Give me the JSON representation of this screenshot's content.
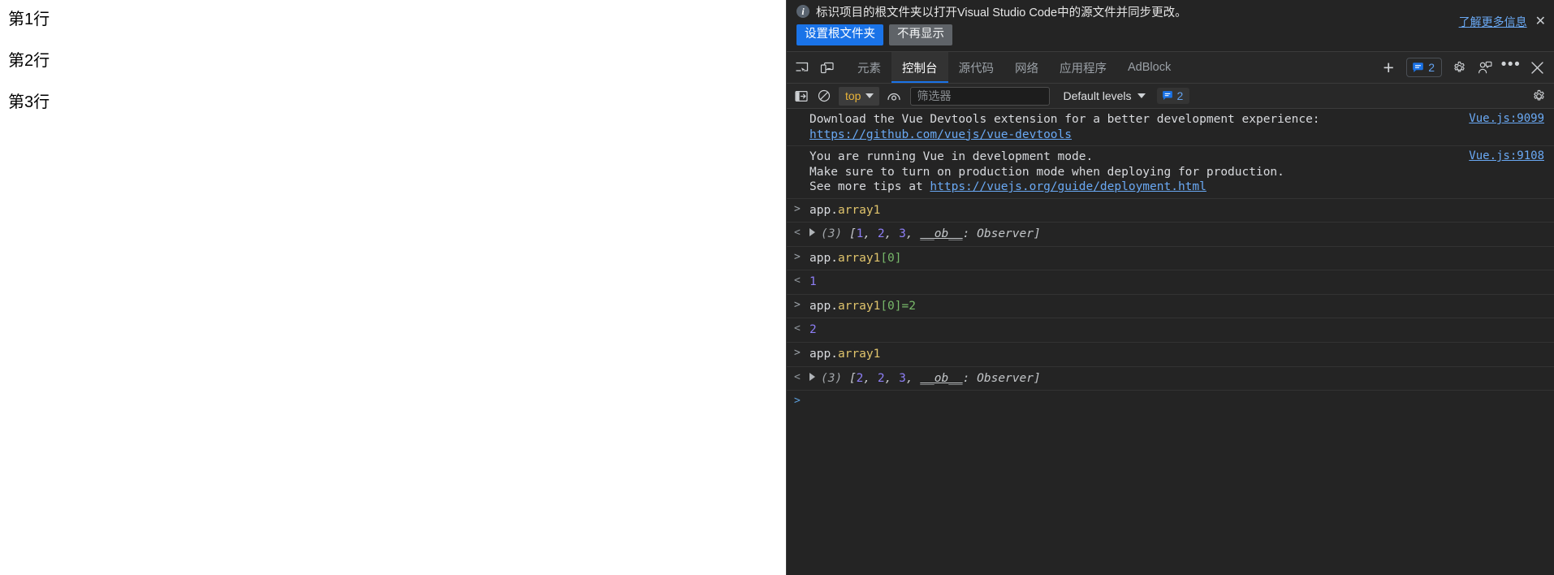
{
  "page": {
    "lines": [
      "第1行",
      "第2行",
      "第3行"
    ]
  },
  "devtools": {
    "banner": {
      "icon": "info-icon",
      "message": "标识项目的根文件夹以打开Visual Studio Code中的源文件并同步更改。",
      "primary_button": "设置根文件夹",
      "secondary_button": "不再显示",
      "learn_more": "了解更多信息",
      "close": "✕",
      "accent_color": "#1a73e8"
    },
    "tabbar": {
      "inspect_icon": "inspect-element-icon",
      "device_icon": "device-toolbar-icon",
      "tabs": [
        {
          "label": "元素",
          "active": false
        },
        {
          "label": "控制台",
          "active": true
        },
        {
          "label": "源代码",
          "active": false
        },
        {
          "label": "网络",
          "active": false
        },
        {
          "label": "应用程序",
          "active": false
        },
        {
          "label": "AdBlock",
          "active": false
        }
      ],
      "add_tab": "+",
      "message_count": "2",
      "settings_icon": "gear-icon",
      "account_icon": "user-feedback-icon",
      "more_icon": "more-options-icon",
      "close_icon": "close-devtools-icon"
    },
    "filterbar": {
      "sidebar_icon": "console-sidebar-icon",
      "clear_icon": "clear-console-icon",
      "context": "top",
      "eye_icon": "live-expression-icon",
      "filter_placeholder": "筛选器",
      "filter_value": "",
      "levels": "Default levels",
      "issue_count": "2",
      "settings_icon": "console-settings-icon"
    },
    "console": {
      "messages": [
        {
          "type": "info",
          "line1": "Download the Vue Devtools extension for a better development experience:",
          "link": "https://github.com/vuejs/vue-devtools",
          "source": "Vue.js:9099"
        },
        {
          "type": "info",
          "line1": "You are running Vue in development mode.",
          "line2": "Make sure to turn on production mode when deploying for production.",
          "line3_prefix": "See more tips at ",
          "link": "https://vuejs.org/guide/deployment.html",
          "source": "Vue.js:9108"
        }
      ],
      "entries": [
        {
          "kind": "input",
          "marker": ">",
          "object": "app",
          "dot": ".",
          "prop": "array1"
        },
        {
          "kind": "output-array",
          "marker": "<",
          "count": "(3)",
          "open": "[",
          "values": [
            "1",
            "2",
            "3"
          ],
          "ob": "__ob__",
          "ob_sep": ": ",
          "observer": "Observer",
          "close": "]"
        },
        {
          "kind": "input",
          "marker": ">",
          "object": "app",
          "dot": ".",
          "prop": "array1",
          "index": "[0]"
        },
        {
          "kind": "output-value",
          "marker": "<",
          "value": "1"
        },
        {
          "kind": "input",
          "marker": ">",
          "object": "app",
          "dot": ".",
          "prop": "array1",
          "index": "[0]",
          "assign": "=2"
        },
        {
          "kind": "output-value",
          "marker": "<",
          "value": "2"
        },
        {
          "kind": "input",
          "marker": ">",
          "object": "app",
          "dot": ".",
          "prop": "array1"
        },
        {
          "kind": "output-array",
          "marker": "<",
          "count": "(3)",
          "open": "[",
          "values": [
            "2",
            "2",
            "3"
          ],
          "ob": "__ob__",
          "ob_sep": ": ",
          "observer": "Observer",
          "close": "]"
        },
        {
          "kind": "prompt",
          "marker": ">"
        }
      ]
    }
  }
}
